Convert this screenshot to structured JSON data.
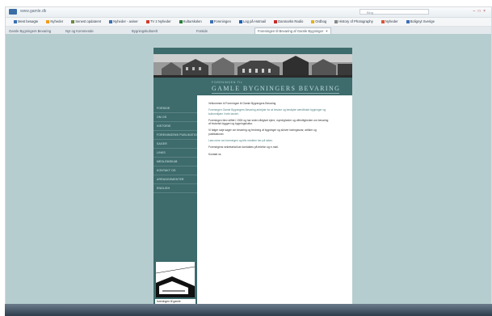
{
  "browser": {
    "address": "www.gamle.dk",
    "search_placeholder": "Bing",
    "window_controls": "– □ ×",
    "bookmarks": [
      {
        "label": "Mest besøgte",
        "color": "#3b6fb5"
      },
      {
        "label": "Nyheder",
        "color": "#f29a1d"
      },
      {
        "label": "Senest opdateret",
        "color": "#6a8b3c"
      },
      {
        "label": "Nyheder - aviser",
        "color": "#3b6fb5"
      },
      {
        "label": "TV 2 Nyheder",
        "color": "#d23b2a"
      },
      {
        "label": "Kulturskolen",
        "color": "#2a7c3a"
      },
      {
        "label": "Foreningen",
        "color": "#3b6fb5"
      },
      {
        "label": "Log på Hotmail",
        "color": "#1d5fb0"
      },
      {
        "label": "Danmarks Radio",
        "color": "#c72b2b"
      },
      {
        "label": "Ordbog",
        "color": "#e3b21f"
      },
      {
        "label": "History of Photography",
        "color": "#888888"
      },
      {
        "label": "Nyheder",
        "color": "#d8563a"
      },
      {
        "label": "Bolignyt Sverige",
        "color": "#3b6fb5"
      }
    ],
    "tabs": [
      {
        "label": "Gamle Bygningers Bevaring",
        "active": false
      },
      {
        "label": "Nyt og Kommende",
        "active": false
      },
      {
        "label": "Bygningskulturelt",
        "active": false
      },
      {
        "label": "Forside",
        "active": false
      },
      {
        "label": "Foreningen til Bevaring af Gamle Bygninger",
        "active": true
      }
    ],
    "new_tab": "+"
  },
  "site": {
    "subtitle": "FORENINGEN TIL",
    "title": "GAMLE BYGNINGERS BEVARING",
    "nav": [
      "FORSIDE",
      "OM OS",
      "HISTORIE",
      "FORENINGENS PUBLIKATIONER",
      "SAGER",
      "LINKS",
      "MEDLEMSKAB",
      "KONTAKT OS",
      "ARRANGEMENTER",
      "ENGLISH"
    ],
    "body": [
      {
        "text": "Velkommen til Foreningen til Gamle Bygningers Bevaring",
        "style": "dark"
      },
      {
        "text": "Foreningen Gamle Bygningers Bevaring arbejder for at bevare og beskytte værdifulde bygninger og kulturmiljøer i hele landet.",
        "style": "teal"
      },
      {
        "text": "Foreningen blev stiftet i 1926 og har siden rådgivet ejere, myndigheder og offentligheden om bevaring af historisk byggeri og bygningskultur.",
        "style": "dark"
      },
      {
        "text": "Vi følger nøje sager om bevaring og fredning af bygninger og skriver høringssvar, artikler og publikationer.",
        "style": "dark"
      },
      {
        "text": "Læs mere om foreningen og bliv medlem her på siden.",
        "style": "teal"
      },
      {
        "text": "Foreningens sekretariat kan kontaktes på telefon og e-mail.",
        "style": "dark"
      },
      {
        "text": "Kontakt os",
        "style": "dark"
      }
    ],
    "stamp": {
      "line1": "foreningen til gamle",
      "line2": "BYGNINGERS BEVARING"
    }
  }
}
